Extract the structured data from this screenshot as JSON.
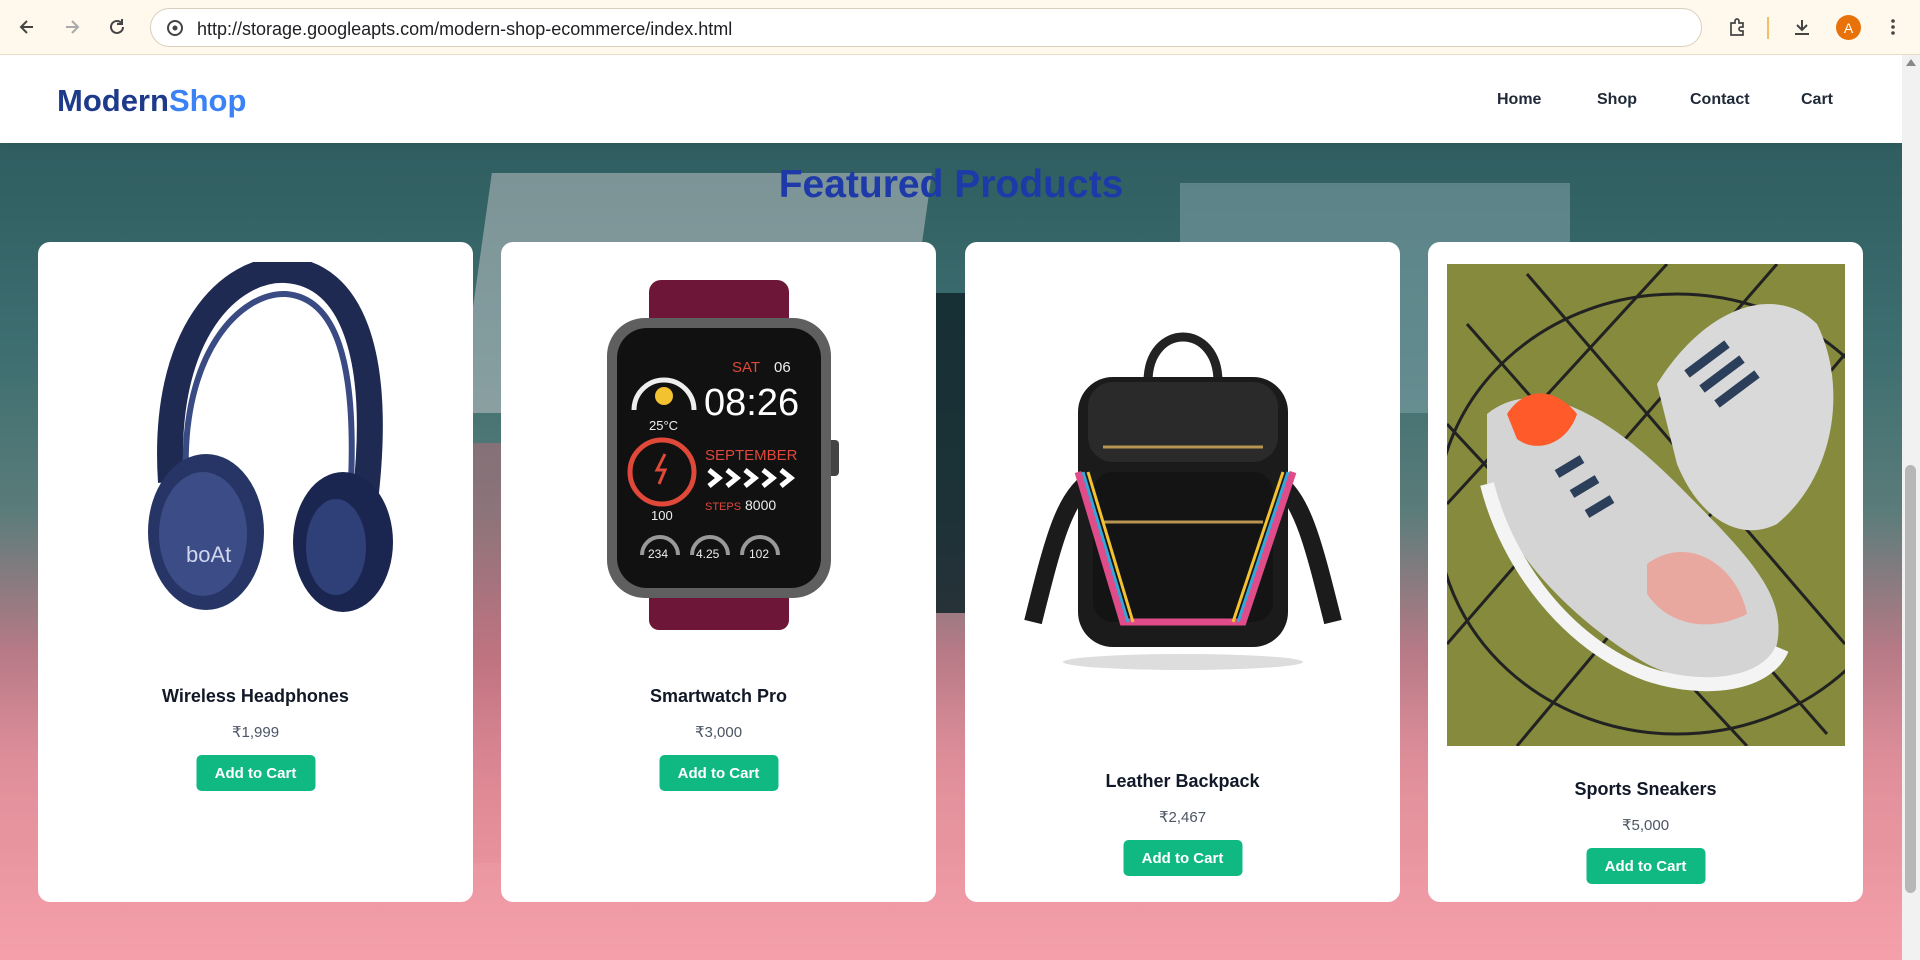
{
  "browser": {
    "url": "http://storage.googleapts.com/modern-shop-ecommerce/index.html",
    "profile_initial": "A"
  },
  "site": {
    "logo_part1": "Modern",
    "logo_part2": "Shop",
    "nav": [
      "Home",
      "Shop",
      "Contact",
      "Cart"
    ]
  },
  "section": {
    "title": "Featured Products"
  },
  "products": [
    {
      "name": "Wireless Headphones",
      "price": "₹1,999",
      "button": "Add to Cart"
    },
    {
      "name": "Smartwatch Pro",
      "price": "₹3,000",
      "button": "Add to Cart"
    },
    {
      "name": "Leather Backpack",
      "price": "₹2,467",
      "button": "Add to Cart"
    },
    {
      "name": "Sports Sneakers",
      "price": "₹5,000",
      "button": "Add to Cart"
    }
  ],
  "watch_face": {
    "day": "SAT",
    "date": "06",
    "time": "08:26",
    "temp": "25°C",
    "month": "SEPTEMBER",
    "steps_label": "STEPS",
    "steps": "8000",
    "battery": "100",
    "stat1": "234",
    "stat2": "4.25",
    "stat3": "102"
  },
  "headphone_brand": "boAt",
  "colors": {
    "accent_button": "#10b981",
    "title_blue": "#1d3aa8",
    "logo_dark": "#1e3a8a",
    "logo_light": "#3b82f6"
  }
}
